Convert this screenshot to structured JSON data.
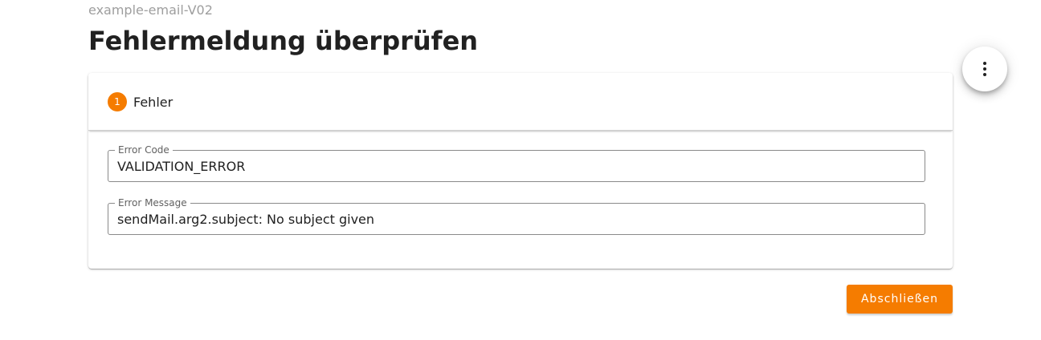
{
  "header": {
    "process_id": "example-email-V02",
    "title": "Fehlermeldung überprüfen"
  },
  "stepper": {
    "steps": [
      {
        "number": "1",
        "label": "Fehler"
      }
    ]
  },
  "form": {
    "error_code": {
      "label": "Error Code",
      "value": "VALIDATION_ERROR"
    },
    "error_message": {
      "label": "Error Message",
      "value": "sendMail.arg2.subject: No subject given"
    }
  },
  "actions": {
    "finish_label": "Abschließen"
  },
  "colors": {
    "accent": "#f57c00",
    "text": "#212121",
    "muted": "#9e9e9e"
  },
  "icons": {
    "menu": "more-vert-icon"
  }
}
